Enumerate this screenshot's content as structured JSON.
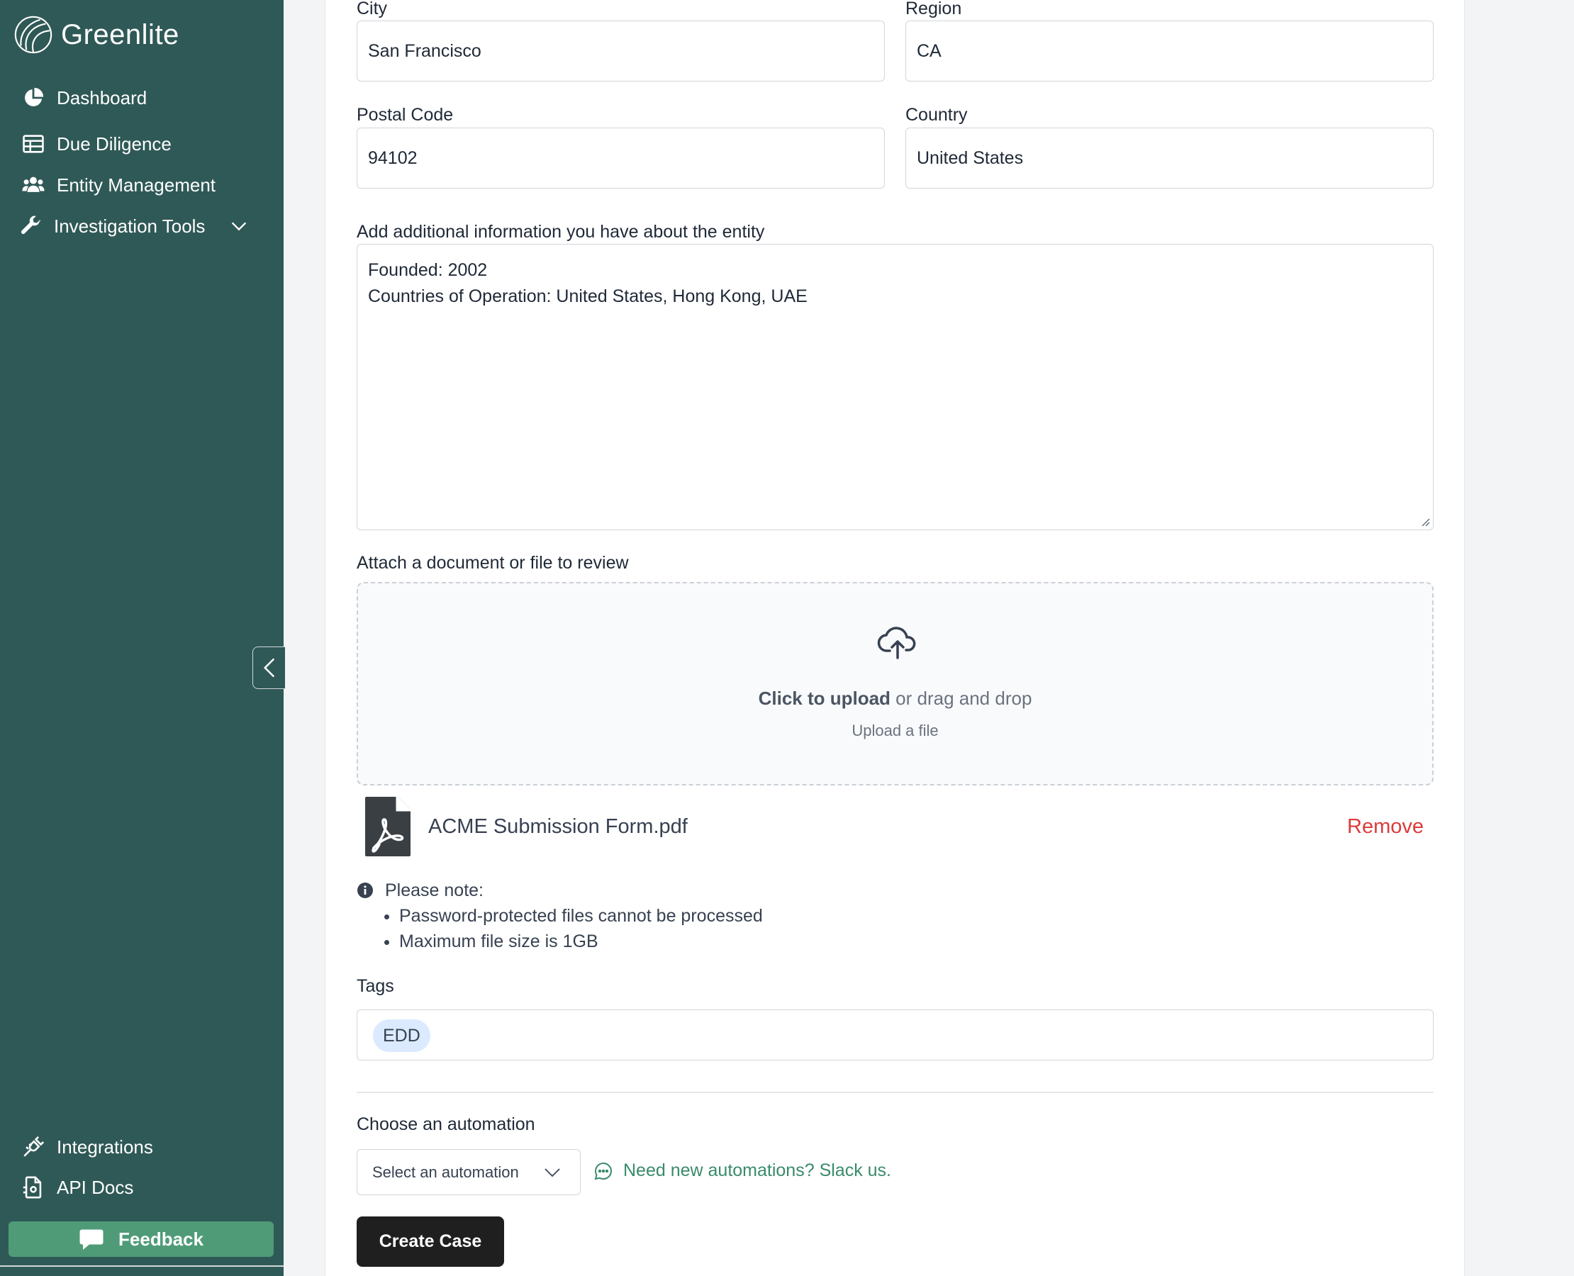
{
  "app": {
    "name": "Greenlite"
  },
  "sidebar": {
    "items": [
      {
        "label": "Dashboard",
        "icon": "pie-chart-icon"
      },
      {
        "label": "Due Diligence",
        "icon": "table-icon"
      },
      {
        "label": "Entity Management",
        "icon": "users-icon"
      },
      {
        "label": "Investigation Tools",
        "icon": "wrench-icon"
      }
    ],
    "bottom_items": [
      {
        "label": "Integrations",
        "icon": "plug-icon"
      },
      {
        "label": "API Docs",
        "icon": "document-code-icon"
      }
    ],
    "feedback_label": "Feedback"
  },
  "form": {
    "city": {
      "label": "City",
      "value": "San Francisco"
    },
    "region": {
      "label": "Region",
      "value": "CA"
    },
    "postal_code": {
      "label": "Postal Code",
      "value": "94102"
    },
    "country": {
      "label": "Country",
      "value": "United States"
    },
    "additional_info": {
      "label": "Add additional information you have about the entity",
      "lines": [
        "Founded: 2002",
        "Countries of Operation: United States, Hong Kong, UAE"
      ]
    },
    "attach": {
      "label": "Attach a document or file to review",
      "click_text": "Click to upload",
      "drag_text": " or drag and drop",
      "sub_text": "Upload a file",
      "file_name": "ACME Submission Form.pdf",
      "remove_label": "Remove"
    },
    "note": {
      "title": "Please note:",
      "items": [
        "Password-protected files cannot be processed",
        "Maximum file size is 1GB"
      ]
    },
    "tags": {
      "label": "Tags",
      "items": [
        "EDD"
      ]
    },
    "automation": {
      "label": "Choose an automation",
      "select_placeholder": "Select an automation",
      "slack_link": "Need new automations? Slack us."
    },
    "submit_label": "Create Case"
  },
  "colors": {
    "sidebar_bg": "#2f5956",
    "feedback_bg": "#4f9b78",
    "remove": "#dc3b3b",
    "link": "#3a8a6b",
    "tag_bg": "#dbeafe"
  }
}
